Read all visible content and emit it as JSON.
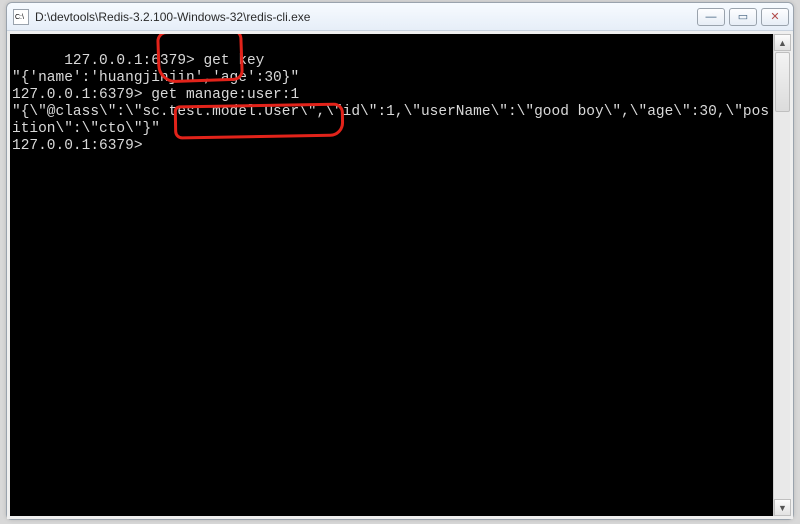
{
  "window": {
    "title": "D:\\devtools\\Redis-3.2.100-Windows-32\\redis-cli.exe"
  },
  "buttons": {
    "minimize_glyph": "—",
    "maximize_glyph": "▭",
    "close_glyph": "✕"
  },
  "scrollbar": {
    "up_glyph": "▲",
    "down_glyph": "▼"
  },
  "terminal": {
    "lines": [
      "127.0.0.1:6379> get key",
      "\"{'name':'huangjinjin','age':30}\"",
      "127.0.0.1:6379> get manage:user:1",
      "\"{\\\"@class\\\":\\\"sc.test.model.User\\\",\\\"id\\\":1,\\\"userName\\\":\\\"good boy\\\",\\\"age\\\":30,\\\"position\\\":\\\"cto\\\"}\"",
      "127.0.0.1:6379>"
    ]
  },
  "annotations": {
    "mark1_target": "get key",
    "mark2_target": "get manage:user:1"
  }
}
